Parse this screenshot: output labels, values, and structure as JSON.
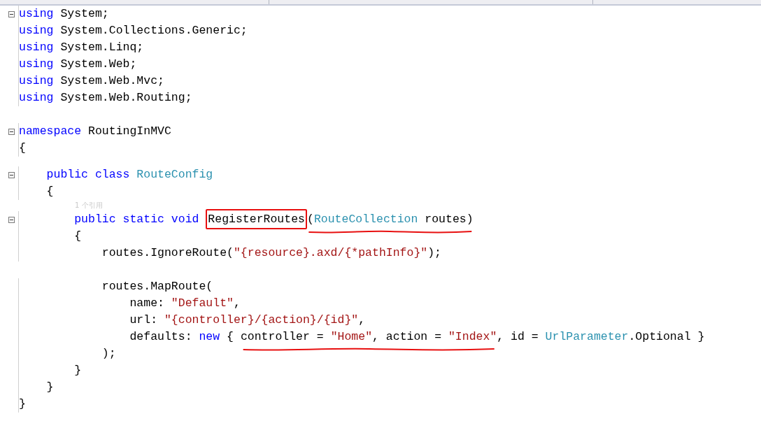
{
  "lines": [
    {
      "kind": "code",
      "expanded": true,
      "segments": [
        {
          "tokens": [
            {
              "kind": "keyword",
              "text": "using"
            },
            {
              "kind": "plain",
              "text": " System;"
            }
          ]
        }
      ]
    },
    {
      "kind": "code",
      "segments": [
        {
          "tokens": [
            {
              "kind": "keyword",
              "text": "using"
            },
            {
              "kind": "plain",
              "text": " System.Collections.Generic;"
            }
          ]
        }
      ]
    },
    {
      "kind": "code",
      "segments": [
        {
          "tokens": [
            {
              "kind": "keyword",
              "text": "using"
            },
            {
              "kind": "plain",
              "text": " System.Linq;"
            }
          ]
        }
      ]
    },
    {
      "kind": "code",
      "segments": [
        {
          "tokens": [
            {
              "kind": "keyword",
              "text": "using"
            },
            {
              "kind": "plain",
              "text": " System.Web;"
            }
          ]
        }
      ]
    },
    {
      "kind": "code",
      "segments": [
        {
          "tokens": [
            {
              "kind": "keyword",
              "text": "using"
            },
            {
              "kind": "plain",
              "text": " System.Web.Mvc;"
            }
          ]
        }
      ]
    },
    {
      "kind": "code",
      "segments": [
        {
          "tokens": [
            {
              "kind": "keyword",
              "text": "using"
            },
            {
              "kind": "plain",
              "text": " System.Web.Routing;"
            }
          ]
        }
      ]
    },
    {
      "kind": "blank"
    },
    {
      "kind": "code",
      "expanded": true,
      "segments": [
        {
          "tokens": [
            {
              "kind": "keyword",
              "text": "namespace"
            },
            {
              "kind": "plain",
              "text": " RoutingInMVC"
            }
          ]
        }
      ]
    },
    {
      "kind": "code",
      "segments": [
        {
          "tokens": [
            {
              "kind": "plain",
              "text": "{"
            }
          ]
        }
      ]
    },
    {
      "kind": "gap"
    },
    {
      "kind": "code",
      "expanded": true,
      "segments": [
        {
          "tokens": [
            {
              "kind": "keyword",
              "text": "    public class "
            },
            {
              "kind": "type",
              "text": "RouteConfig"
            }
          ]
        }
      ]
    },
    {
      "kind": "code",
      "segments": [
        {
          "tokens": [
            {
              "kind": "plain",
              "text": "    {"
            }
          ]
        }
      ]
    },
    {
      "kind": "codelens",
      "text": "1 个引用"
    },
    {
      "kind": "code",
      "expanded": true,
      "segments": [
        {
          "tokens": [
            {
              "kind": "keyword",
              "text": "        public static void "
            }
          ]
        },
        {
          "kind": "boxed",
          "tokens": [
            {
              "kind": "plain",
              "text": "RegisterRoutes"
            }
          ]
        },
        {
          "kind": "underlined",
          "tokens": [
            {
              "kind": "plain",
              "text": "("
            },
            {
              "kind": "type",
              "text": "RouteCollection"
            },
            {
              "kind": "plain",
              "text": " routes)"
            }
          ]
        }
      ]
    },
    {
      "kind": "code",
      "segments": [
        {
          "tokens": [
            {
              "kind": "plain",
              "text": "        {"
            }
          ]
        }
      ]
    },
    {
      "kind": "code",
      "segments": [
        {
          "tokens": [
            {
              "kind": "plain",
              "text": "            routes.IgnoreRoute("
            },
            {
              "kind": "string",
              "text": "\"{resource}.axd/{*pathInfo}\""
            },
            {
              "kind": "plain",
              "text": ");"
            }
          ]
        }
      ]
    },
    {
      "kind": "blank"
    },
    {
      "kind": "code",
      "segments": [
        {
          "tokens": [
            {
              "kind": "plain",
              "text": "            routes.MapRoute("
            }
          ]
        }
      ]
    },
    {
      "kind": "code",
      "segments": [
        {
          "tokens": [
            {
              "kind": "plain",
              "text": "                name: "
            },
            {
              "kind": "string",
              "text": "\"Default\""
            },
            {
              "kind": "plain",
              "text": ","
            }
          ]
        }
      ]
    },
    {
      "kind": "code",
      "segments": [
        {
          "tokens": [
            {
              "kind": "plain",
              "text": "                url: "
            },
            {
              "kind": "string",
              "text": "\"{controller}/{action}/{id}\""
            },
            {
              "kind": "plain",
              "text": ","
            }
          ]
        }
      ]
    },
    {
      "kind": "code",
      "segments": [
        {
          "tokens": [
            {
              "kind": "plain",
              "text": "                defaults: "
            },
            {
              "kind": "keyword",
              "text": "new"
            },
            {
              "kind": "plain",
              "text": " { "
            }
          ]
        },
        {
          "kind": "underlined",
          "tokens": [
            {
              "kind": "plain",
              "text": "controller = "
            },
            {
              "kind": "string",
              "text": "\"Home\""
            },
            {
              "kind": "plain",
              "text": ", action = "
            },
            {
              "kind": "string",
              "text": "\"Index\""
            }
          ]
        },
        {
          "tokens": [
            {
              "kind": "plain",
              "text": ", id = "
            },
            {
              "kind": "type",
              "text": "UrlParameter"
            },
            {
              "kind": "plain",
              "text": ".Optional }"
            }
          ]
        }
      ]
    },
    {
      "kind": "code",
      "segments": [
        {
          "tokens": [
            {
              "kind": "plain",
              "text": "            );"
            }
          ]
        }
      ]
    },
    {
      "kind": "code",
      "segments": [
        {
          "tokens": [
            {
              "kind": "plain",
              "text": "        }"
            }
          ]
        }
      ]
    },
    {
      "kind": "code",
      "segments": [
        {
          "tokens": [
            {
              "kind": "plain",
              "text": "    }"
            }
          ]
        }
      ]
    },
    {
      "kind": "code",
      "segments": [
        {
          "tokens": [
            {
              "kind": "plain",
              "text": "}"
            }
          ]
        }
      ]
    }
  ]
}
